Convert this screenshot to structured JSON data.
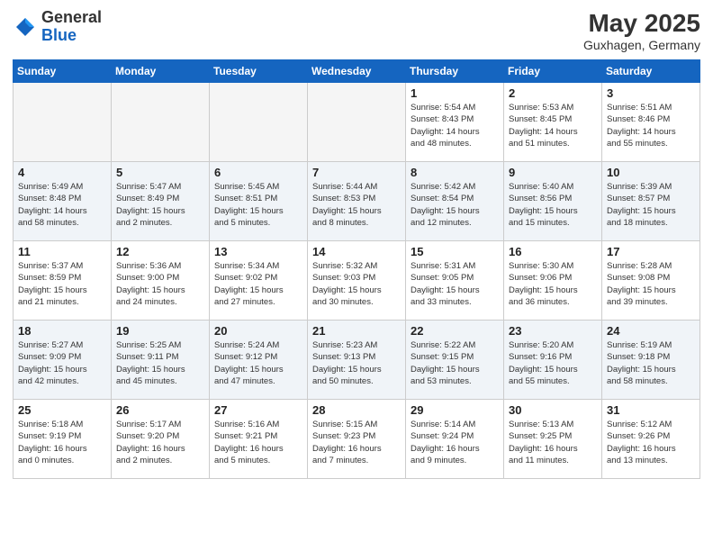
{
  "header": {
    "logo_general": "General",
    "logo_blue": "Blue",
    "month_year": "May 2025",
    "location": "Guxhagen, Germany"
  },
  "weekdays": [
    "Sunday",
    "Monday",
    "Tuesday",
    "Wednesday",
    "Thursday",
    "Friday",
    "Saturday"
  ],
  "weeks": [
    [
      {
        "day": "",
        "info": ""
      },
      {
        "day": "",
        "info": ""
      },
      {
        "day": "",
        "info": ""
      },
      {
        "day": "",
        "info": ""
      },
      {
        "day": "1",
        "info": "Sunrise: 5:54 AM\nSunset: 8:43 PM\nDaylight: 14 hours\nand 48 minutes."
      },
      {
        "day": "2",
        "info": "Sunrise: 5:53 AM\nSunset: 8:45 PM\nDaylight: 14 hours\nand 51 minutes."
      },
      {
        "day": "3",
        "info": "Sunrise: 5:51 AM\nSunset: 8:46 PM\nDaylight: 14 hours\nand 55 minutes."
      }
    ],
    [
      {
        "day": "4",
        "info": "Sunrise: 5:49 AM\nSunset: 8:48 PM\nDaylight: 14 hours\nand 58 minutes."
      },
      {
        "day": "5",
        "info": "Sunrise: 5:47 AM\nSunset: 8:49 PM\nDaylight: 15 hours\nand 2 minutes."
      },
      {
        "day": "6",
        "info": "Sunrise: 5:45 AM\nSunset: 8:51 PM\nDaylight: 15 hours\nand 5 minutes."
      },
      {
        "day": "7",
        "info": "Sunrise: 5:44 AM\nSunset: 8:53 PM\nDaylight: 15 hours\nand 8 minutes."
      },
      {
        "day": "8",
        "info": "Sunrise: 5:42 AM\nSunset: 8:54 PM\nDaylight: 15 hours\nand 12 minutes."
      },
      {
        "day": "9",
        "info": "Sunrise: 5:40 AM\nSunset: 8:56 PM\nDaylight: 15 hours\nand 15 minutes."
      },
      {
        "day": "10",
        "info": "Sunrise: 5:39 AM\nSunset: 8:57 PM\nDaylight: 15 hours\nand 18 minutes."
      }
    ],
    [
      {
        "day": "11",
        "info": "Sunrise: 5:37 AM\nSunset: 8:59 PM\nDaylight: 15 hours\nand 21 minutes."
      },
      {
        "day": "12",
        "info": "Sunrise: 5:36 AM\nSunset: 9:00 PM\nDaylight: 15 hours\nand 24 minutes."
      },
      {
        "day": "13",
        "info": "Sunrise: 5:34 AM\nSunset: 9:02 PM\nDaylight: 15 hours\nand 27 minutes."
      },
      {
        "day": "14",
        "info": "Sunrise: 5:32 AM\nSunset: 9:03 PM\nDaylight: 15 hours\nand 30 minutes."
      },
      {
        "day": "15",
        "info": "Sunrise: 5:31 AM\nSunset: 9:05 PM\nDaylight: 15 hours\nand 33 minutes."
      },
      {
        "day": "16",
        "info": "Sunrise: 5:30 AM\nSunset: 9:06 PM\nDaylight: 15 hours\nand 36 minutes."
      },
      {
        "day": "17",
        "info": "Sunrise: 5:28 AM\nSunset: 9:08 PM\nDaylight: 15 hours\nand 39 minutes."
      }
    ],
    [
      {
        "day": "18",
        "info": "Sunrise: 5:27 AM\nSunset: 9:09 PM\nDaylight: 15 hours\nand 42 minutes."
      },
      {
        "day": "19",
        "info": "Sunrise: 5:25 AM\nSunset: 9:11 PM\nDaylight: 15 hours\nand 45 minutes."
      },
      {
        "day": "20",
        "info": "Sunrise: 5:24 AM\nSunset: 9:12 PM\nDaylight: 15 hours\nand 47 minutes."
      },
      {
        "day": "21",
        "info": "Sunrise: 5:23 AM\nSunset: 9:13 PM\nDaylight: 15 hours\nand 50 minutes."
      },
      {
        "day": "22",
        "info": "Sunrise: 5:22 AM\nSunset: 9:15 PM\nDaylight: 15 hours\nand 53 minutes."
      },
      {
        "day": "23",
        "info": "Sunrise: 5:20 AM\nSunset: 9:16 PM\nDaylight: 15 hours\nand 55 minutes."
      },
      {
        "day": "24",
        "info": "Sunrise: 5:19 AM\nSunset: 9:18 PM\nDaylight: 15 hours\nand 58 minutes."
      }
    ],
    [
      {
        "day": "25",
        "info": "Sunrise: 5:18 AM\nSunset: 9:19 PM\nDaylight: 16 hours\nand 0 minutes."
      },
      {
        "day": "26",
        "info": "Sunrise: 5:17 AM\nSunset: 9:20 PM\nDaylight: 16 hours\nand 2 minutes."
      },
      {
        "day": "27",
        "info": "Sunrise: 5:16 AM\nSunset: 9:21 PM\nDaylight: 16 hours\nand 5 minutes."
      },
      {
        "day": "28",
        "info": "Sunrise: 5:15 AM\nSunset: 9:23 PM\nDaylight: 16 hours\nand 7 minutes."
      },
      {
        "day": "29",
        "info": "Sunrise: 5:14 AM\nSunset: 9:24 PM\nDaylight: 16 hours\nand 9 minutes."
      },
      {
        "day": "30",
        "info": "Sunrise: 5:13 AM\nSunset: 9:25 PM\nDaylight: 16 hours\nand 11 minutes."
      },
      {
        "day": "31",
        "info": "Sunrise: 5:12 AM\nSunset: 9:26 PM\nDaylight: 16 hours\nand 13 minutes."
      }
    ]
  ]
}
